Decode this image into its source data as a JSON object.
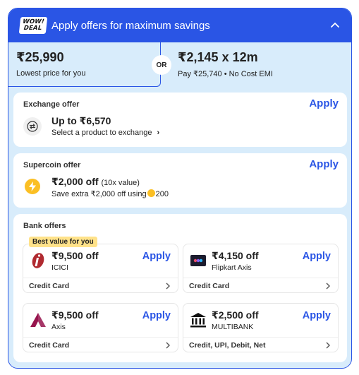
{
  "header": {
    "badge_line1": "WOW!",
    "badge_line2": "DEAL",
    "title": "Apply offers for maximum savings"
  },
  "pricing": {
    "lowest_price": "₹25,990",
    "lowest_label": "Lowest price for you",
    "or_label": "OR",
    "emi_price": "₹2,145 x 12m",
    "emi_label": "Pay ₹25,740 • No Cost EMI"
  },
  "exchange": {
    "title": "Exchange offer",
    "apply_label": "Apply",
    "amount": "Up to ₹6,570",
    "sub": "Select a product to exchange",
    "chevron": "›"
  },
  "supercoin": {
    "title": "Supercoin offer",
    "apply_label": "Apply",
    "amount": "₹2,000 off",
    "multiplier": "(10x value)",
    "sub_prefix": "Save extra ₹2,000 off using",
    "coins": "200"
  },
  "bank_offers": {
    "title": "Bank offers",
    "best_badge": "Best value for you",
    "cards": [
      {
        "amount": "₹9,500 off",
        "bank": "ICICI",
        "apply_label": "Apply",
        "type": "Credit Card",
        "logo": "icici-logo"
      },
      {
        "amount": "₹4,150 off",
        "bank": "Flipkart Axis",
        "apply_label": "Apply",
        "type": "Credit Card",
        "logo": "flipkart-axis-card-icon"
      },
      {
        "amount": "₹9,500 off",
        "bank": "Axis",
        "apply_label": "Apply",
        "type": "Credit Card",
        "logo": "axis-logo"
      },
      {
        "amount": "₹2,500 off",
        "bank": "MULTIBANK",
        "apply_label": "Apply",
        "type": "Credit, UPI, Debit, Net",
        "logo": "bank-building-icon"
      }
    ]
  },
  "colors": {
    "accent": "#2a55e5",
    "panel_bg": "#d8ecfb",
    "badge_bg": "#ffe28a",
    "coin": "#fbbf24"
  }
}
